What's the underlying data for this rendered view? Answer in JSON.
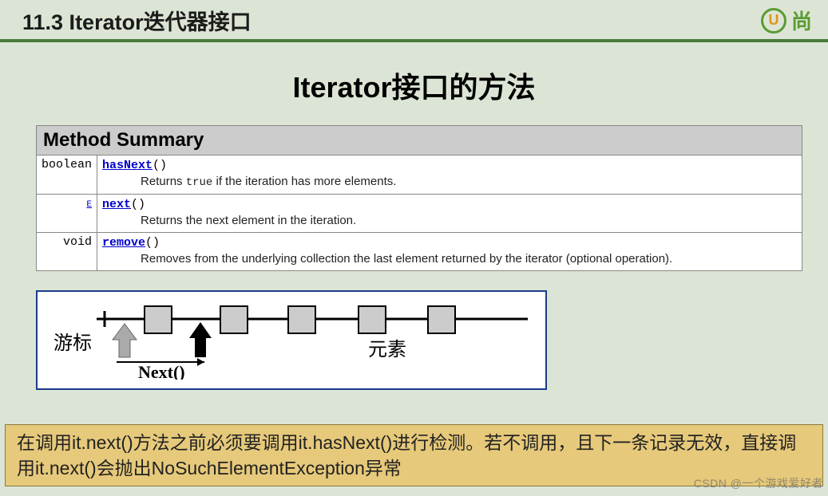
{
  "header": {
    "section": "11.3 Iterator迭代器接口",
    "logo_letter": "U",
    "logo_text": "尚"
  },
  "main_title": "Iterator接口的方法",
  "table": {
    "header": "Method Summary",
    "rows": [
      {
        "ret": "boolean",
        "name": "hasNext",
        "desc_prefix": "Returns ",
        "desc_code": "true",
        "desc_suffix": " if the iteration has more elements."
      },
      {
        "ret": "E",
        "name": "next",
        "desc_prefix": "Returns the next element in the iteration.",
        "desc_code": "",
        "desc_suffix": ""
      },
      {
        "ret": "void",
        "name": "remove",
        "desc_prefix": "Removes from the underlying collection the last element returned by the iterator (optional operation).",
        "desc_code": "",
        "desc_suffix": ""
      }
    ]
  },
  "diagram": {
    "cursor_label": "游标",
    "element_label": "元素",
    "next_label": "Next()"
  },
  "note": "在调用it.next()方法之前必须要调用it.hasNext()进行检测。若不调用，且下一条记录无效，直接调用it.next()会抛出NoSuchElementException异常",
  "watermark": "CSDN @一个游戏爱好者"
}
